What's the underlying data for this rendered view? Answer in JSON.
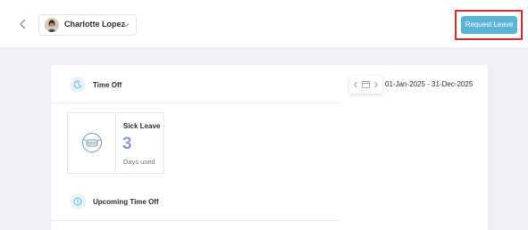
{
  "header": {
    "employee_name": "Charlotte Lopez",
    "request_button": "Request Leave"
  },
  "time_off": {
    "title": "Time Off",
    "date_range": "01-Jan-2025 - 31-Dec-2025",
    "balances": [
      {
        "type": "Sick Leave",
        "count": "3",
        "unit": "Days used",
        "icon": "sick-mask-icon"
      }
    ]
  },
  "upcoming": {
    "title": "Upcoming Time Off"
  },
  "colors": {
    "accent": "#5ab4d8",
    "highlight": "#e0232e",
    "count": "#8d9fc6"
  }
}
